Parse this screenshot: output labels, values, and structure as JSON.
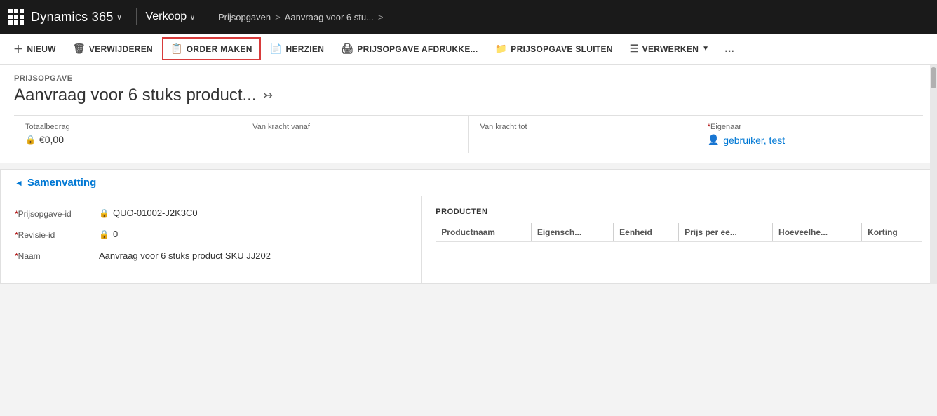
{
  "app": {
    "name": "Dynamics 365",
    "module": "Verkoop",
    "breadcrumb": {
      "item1": "Prijsopgaven",
      "sep": ">",
      "item2": "Aanvraag voor 6 stu...",
      "sep2": ">"
    }
  },
  "toolbar": {
    "new_label": "NIEUW",
    "delete_label": "VERWIJDEREN",
    "order_maken_label": "ORDER MAKEN",
    "herzien_label": "HERZIEN",
    "print_label": "PRIJSOPGAVE AFDRUKKE...",
    "sluiten_label": "PRIJSOPGAVE SLUITEN",
    "verwerken_label": "VERWERKEN",
    "more_label": "..."
  },
  "record": {
    "type_label": "PRIJSOPGAVE",
    "title": "Aanvraag voor 6 stuks product...",
    "menu_icon": "≡"
  },
  "header_fields": {
    "totaalbedrag": {
      "label": "Totaalbedrag",
      "value": "€0,00"
    },
    "van_kracht_vanaf": {
      "label": "Van kracht vanaf"
    },
    "van_kracht_tot": {
      "label": "Van kracht tot"
    },
    "eigenaar": {
      "label": "Eigenaar",
      "value": "gebruiker, test"
    }
  },
  "section": {
    "title": "Samenvatting",
    "collapse_icon": "◄"
  },
  "form_fields": {
    "prijsopgave_id": {
      "label": "Prijsopgave-id",
      "value": "QUO-01002-J2K3C0"
    },
    "revisie_id": {
      "label": "Revisie-id",
      "value": "0"
    },
    "naam": {
      "label": "Naam",
      "value": "Aanvraag voor 6 stuks product SKU JJ202"
    }
  },
  "products_table": {
    "label": "PRODUCTEN",
    "columns": [
      "Productnaam",
      "Eigensch...",
      "Eenheid",
      "Prijs per ee...",
      "Hoeveelhe...",
      "Korting"
    ]
  }
}
